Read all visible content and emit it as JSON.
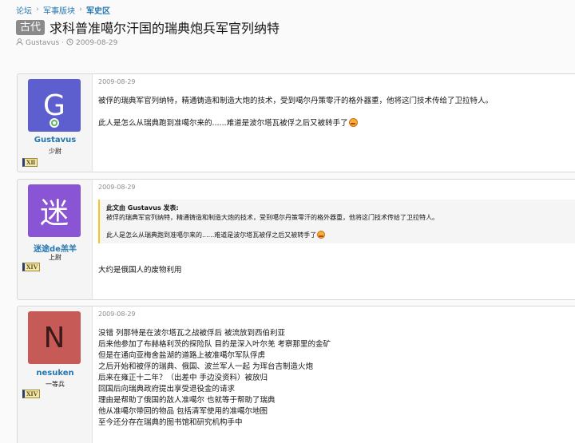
{
  "breadcrumb": [
    "论坛",
    "军事版块",
    "军史区"
  ],
  "thread": {
    "prefix": "古代",
    "title": "求科普准噶尔汗国的瑞典炮兵军官列纳特",
    "author": "Gustavus",
    "date": "2009-08-29"
  },
  "posts": [
    {
      "avatar_letter": "G",
      "avatar_color": "#5d5fcf",
      "username": "Gustavus",
      "usertitle": "少尉",
      "rank": "XⅡ",
      "date": "2009-08-29",
      "body": [
        "被俘的瑞典军官列纳特，精通铸造和制造大炮的技术，受到噶尔丹策零汗的格外器重，他将这门技术传给了卫拉特人。",
        "此人是怎么从瑞典跑到准噶尔来的......难道是波尔塔瓦被俘之后又被转手了"
      ]
    },
    {
      "avatar_letter": "迷",
      "avatar_color": "#8a55d4",
      "username": "迷途de羔羊",
      "usertitle": "上尉",
      "rank": "XIV",
      "date": "2009-08-29",
      "quote_head": "此文由 Gustavus 发表:",
      "quote_lines": [
        "被俘的瑞典军官列纳特，精通铸造和制造大炮的技术，受到噶尔丹策零汗的格外器重，他将这门技术传给了卫拉特人。",
        "此人是怎么从瑞典跑到准噶尔来的......难道是波尔塔瓦被俘之后又被转手了"
      ],
      "body": [
        "大约是俄国人的废物利用"
      ]
    },
    {
      "avatar_letter": "N",
      "avatar_color": "#cf5f5b",
      "username": "nesuken",
      "usertitle": "一等兵",
      "rank": "XIV",
      "date": "2009-08-29",
      "body": [
        "没错 列那特是在波尔塔瓦之战被俘后 被流放到西伯利亚",
        "后来他参加了布赫格利茨的探险队 目的是深入叶尔羌 考察那里的金矿",
        "但是在通向亚梅舍盐湖的道路上被准噶尔军队俘虏",
        "之后开始和被俘的瑞典、俄国、波兰军人一起 为珲台吉制造火炮",
        "后来在雍正十二年？（出差中 手边没资料）被放归",
        "回国后向瑞典政府提出享受退役金的请求",
        "理由是帮助了俄国的敌人准噶尔 也就等于帮助了瑞典",
        "他从准噶尔带回的物品 包括清军使用的准噶尔地图",
        "至今还分存在瑞典的图书馆和研究机构手中"
      ]
    }
  ]
}
